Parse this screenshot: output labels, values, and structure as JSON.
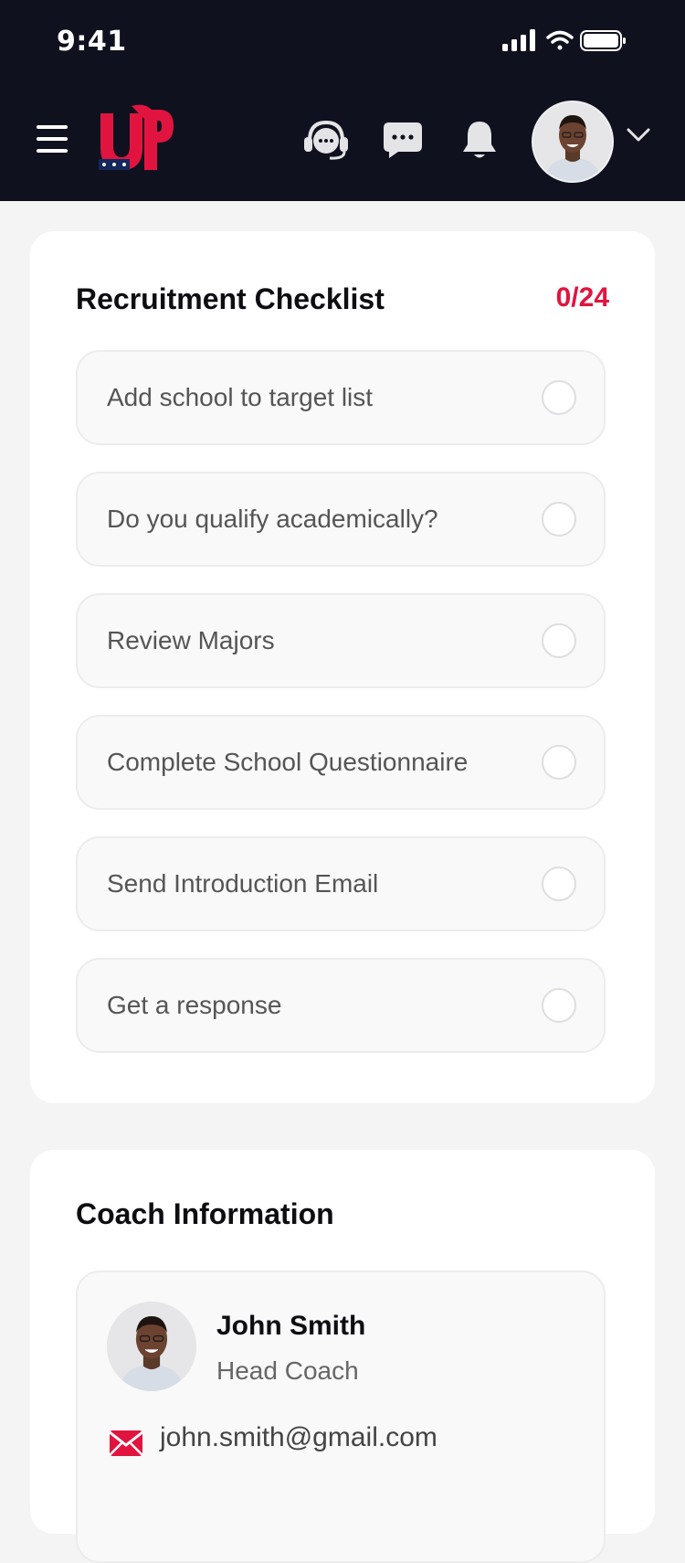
{
  "status_bar": {
    "time": "9:41"
  },
  "header": {
    "logo_text": "UP",
    "icons": [
      "menu-icon",
      "support-headset-icon",
      "chat-bubble-icon",
      "bell-icon",
      "chevron-down-icon"
    ]
  },
  "checklist": {
    "title": "Recruitment Checklist",
    "progress": "0/24",
    "items": [
      {
        "label": "Add school to target list",
        "checked": false
      },
      {
        "label": "Do you qualify academically?",
        "checked": false
      },
      {
        "label": "Review Majors",
        "checked": false
      },
      {
        "label": "Complete School Questionnaire",
        "checked": false
      },
      {
        "label": "Send Introduction Email",
        "checked": false
      },
      {
        "label": "Get a response",
        "checked": false
      }
    ]
  },
  "coach": {
    "title": "Coach Information",
    "name": "John Smith",
    "role": "Head Coach",
    "email": "john.smith@gmail.com"
  },
  "colors": {
    "header_bg": "#0f111e",
    "accent": "#e1143f",
    "navy": "#13275a"
  }
}
